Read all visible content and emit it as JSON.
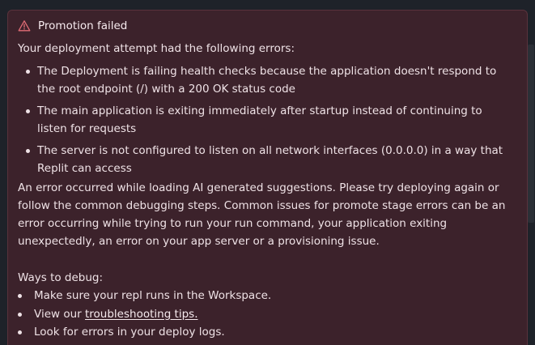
{
  "alert": {
    "title": "Promotion failed",
    "icon": "warning-triangle-icon",
    "accent_color": "#e06c75",
    "intro": "Your deployment attempt had the following errors:",
    "errors": [
      "The Deployment is failing health checks because the application doesn't respond to the root endpoint (/) with a 200 OK status code",
      "The main application is exiting immediately after startup instead of continuing to listen for requests",
      "The server is not configured to listen on all network interfaces (0.0.0.0) in a way that Replit can access"
    ],
    "explanation": "An error occurred while loading AI generated suggestions. Please try deploying again or follow the common debugging steps. Common issues for promote stage errors can be an error occurring while trying to run your run command, your application exiting unexpectedly, an error on your app server or a provisioning issue."
  },
  "debug": {
    "title": "Ways to debug:",
    "item1": "Make sure your repl runs in the Workspace.",
    "item2_prefix": "View our ",
    "item2_link": "troubleshooting tips.",
    "item3": "Look for errors in your deploy logs."
  }
}
